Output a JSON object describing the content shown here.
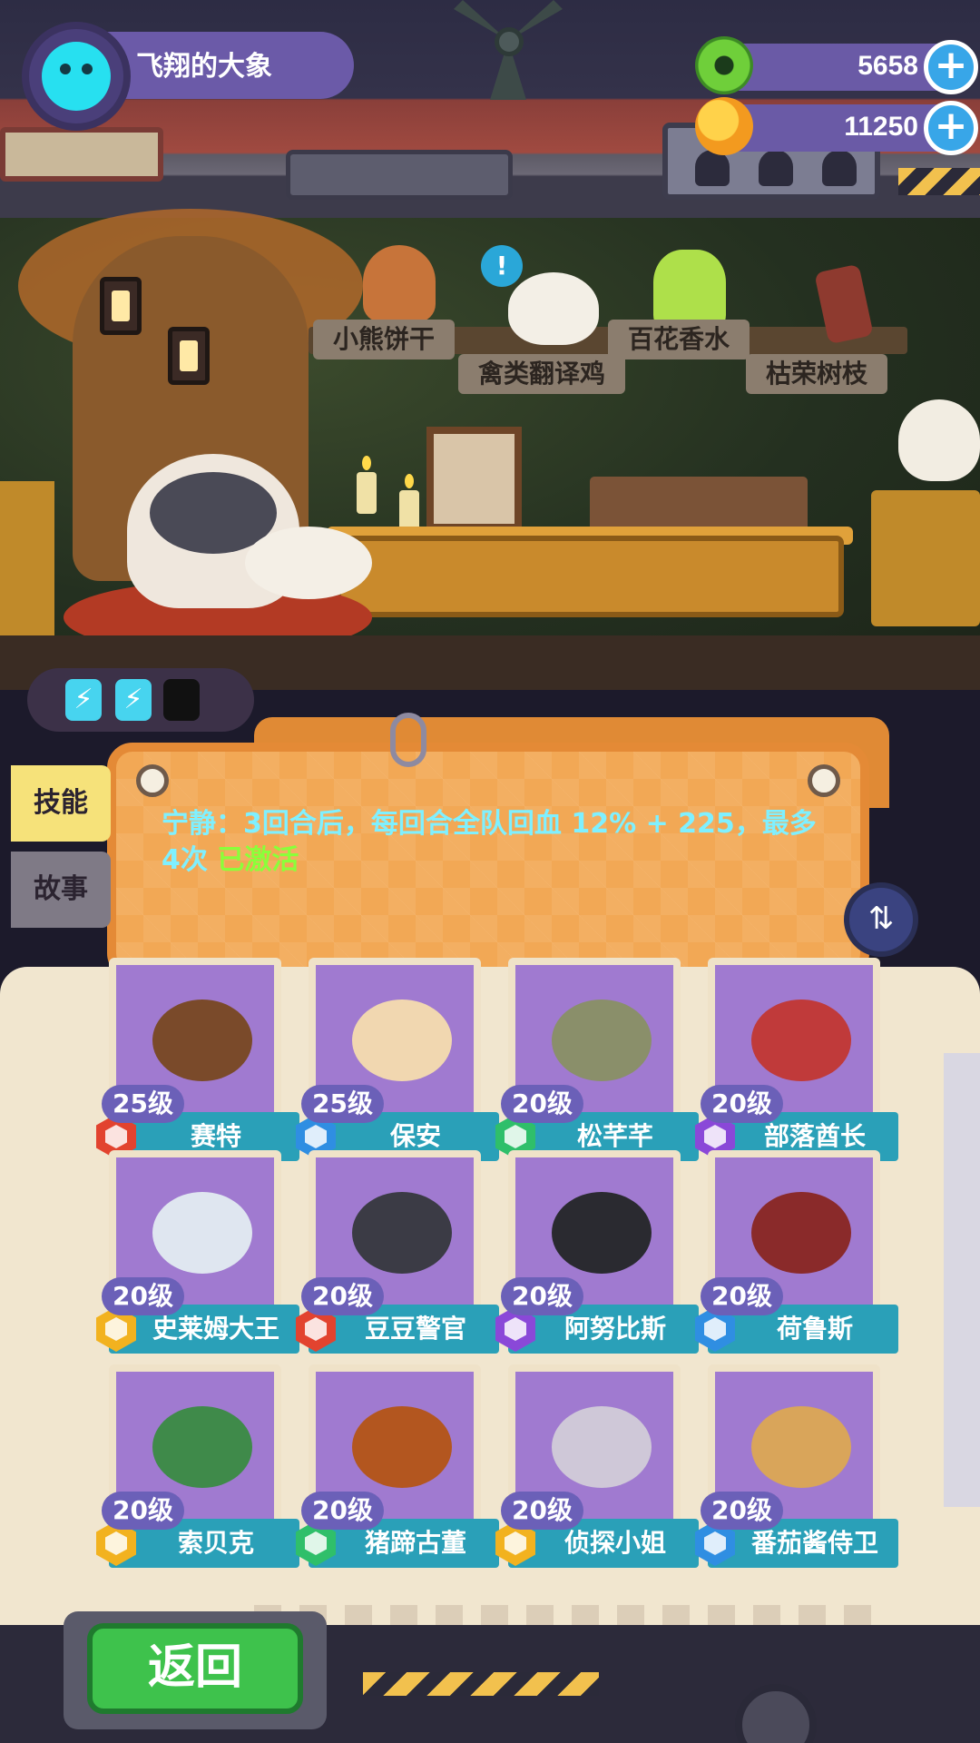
{
  "player": {
    "name": "飞翔的大象"
  },
  "currencies": [
    {
      "icon": "donut-currency-icon",
      "value": "5658"
    },
    {
      "icon": "planet-currency-icon",
      "value": "11250"
    }
  ],
  "shelf_items": [
    {
      "label": "小熊饼干"
    },
    {
      "label": "禽类翻译鸡"
    },
    {
      "label": "百花香水"
    },
    {
      "label": "枯荣树枝"
    }
  ],
  "energy": {
    "filled": 2,
    "total": 3
  },
  "tabs": {
    "skill": "技能",
    "story": "故事"
  },
  "skill": {
    "text": "宁静：3回合后，每回合全队回血 12% + 225，最多4次",
    "status": "已激活"
  },
  "characters": [
    {
      "name": "赛特",
      "level": "25级",
      "rank_color": "#e2432f",
      "portrait_color": "#7a4a2a"
    },
    {
      "name": "保安",
      "level": "25级",
      "rank_color": "#2f8ee2",
      "portrait_color": "#f1d7b0"
    },
    {
      "name": "松芊芊",
      "level": "20级",
      "rank_color": "#2fbf6a",
      "portrait_color": "#8a8f6a"
    },
    {
      "name": "部落酋长",
      "level": "20级",
      "rank_color": "#8a48d8",
      "portrait_color": "#c03a3a"
    },
    {
      "name": "史莱姆大王",
      "level": "20级",
      "rank_color": "#f2b21f",
      "portrait_color": "#dfe6f0"
    },
    {
      "name": "豆豆警官",
      "level": "20级",
      "rank_color": "#e2432f",
      "portrait_color": "#3b3b45"
    },
    {
      "name": "阿努比斯",
      "level": "20级",
      "rank_color": "#8a48d8",
      "portrait_color": "#2a2a30"
    },
    {
      "name": "荷鲁斯",
      "level": "20级",
      "rank_color": "#2f8ee2",
      "portrait_color": "#8a2a2a"
    },
    {
      "name": "索贝克",
      "level": "20级",
      "rank_color": "#f2b21f",
      "portrait_color": "#3f8a4a"
    },
    {
      "name": "猪蹄古董",
      "level": "20级",
      "rank_color": "#2fbf6a",
      "portrait_color": "#b3561f"
    },
    {
      "name": "侦探小姐",
      "level": "20级",
      "rank_color": "#f2b21f",
      "portrait_color": "#cfc8d8"
    },
    {
      "name": "番茄酱侍卫",
      "level": "20级",
      "rank_color": "#2f8ee2",
      "portrait_color": "#d9a55a"
    }
  ],
  "back_button": "返回"
}
